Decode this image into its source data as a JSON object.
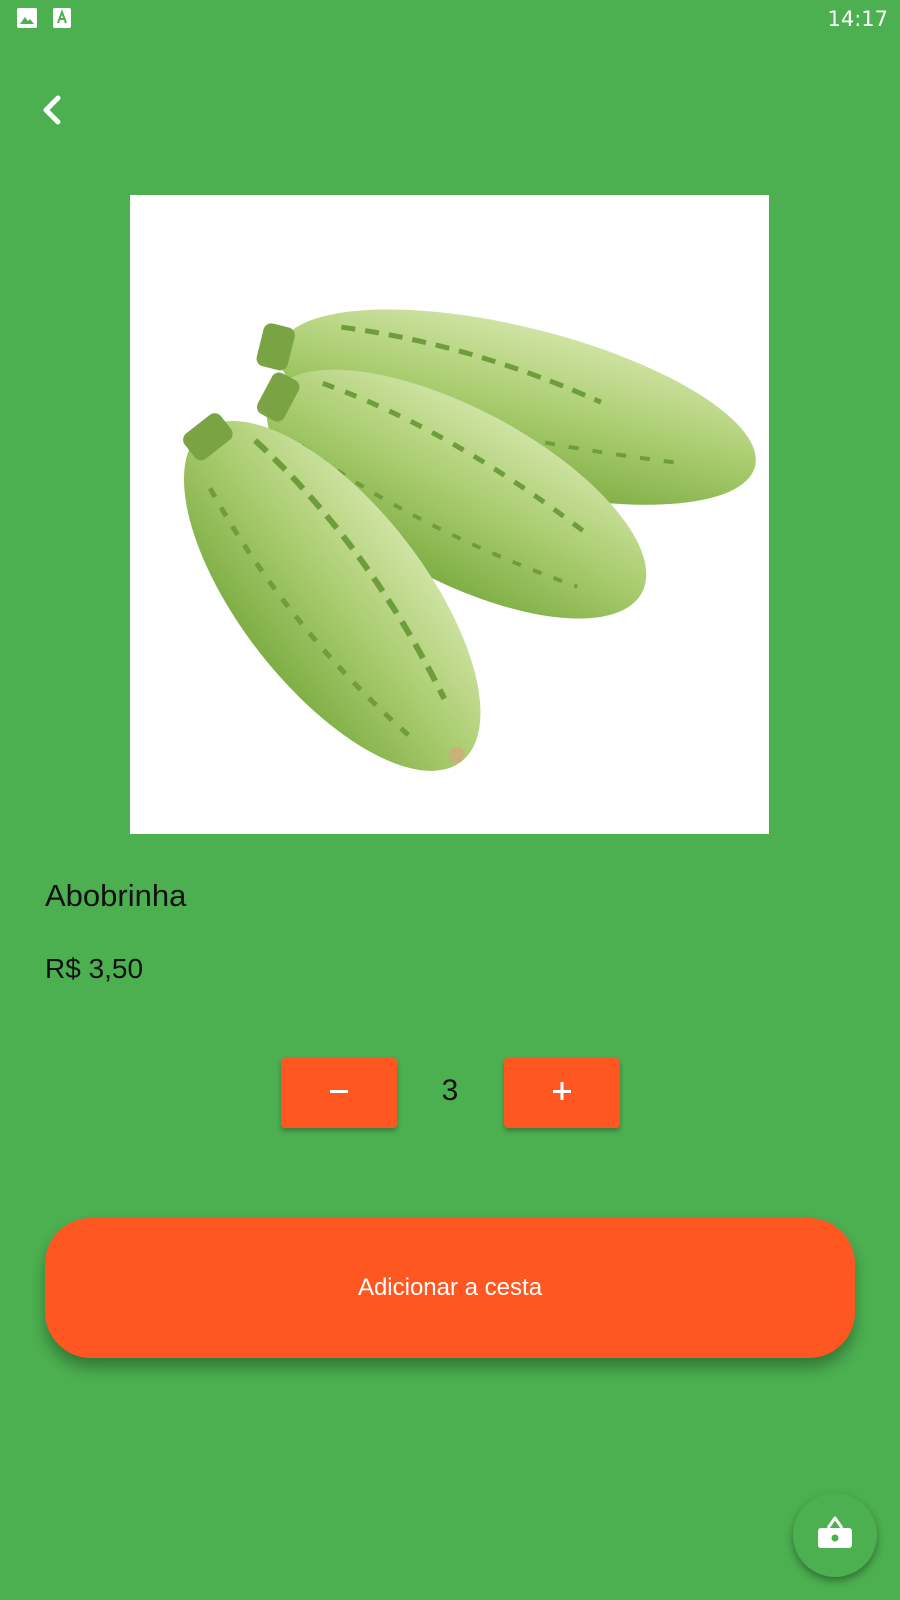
{
  "status_bar": {
    "time": "14:17",
    "icons": [
      "image-icon",
      "text-a-icon"
    ]
  },
  "header": {
    "back_icon": "chevron-left-icon"
  },
  "product": {
    "image_icon": "zucchini-image",
    "name": "Abobrinha",
    "price": "R$ 3,50"
  },
  "quantity": {
    "value": "3",
    "decrease_icon": "minus-icon",
    "increase_icon": "plus-icon"
  },
  "actions": {
    "add_to_basket_label": "Adicionar a cesta",
    "fab_icon": "shopping-bag-icon"
  },
  "colors": {
    "background": "#4CAF50",
    "accent": "#FF5722",
    "text": "#111111",
    "on_accent": "#FFFFFF"
  }
}
